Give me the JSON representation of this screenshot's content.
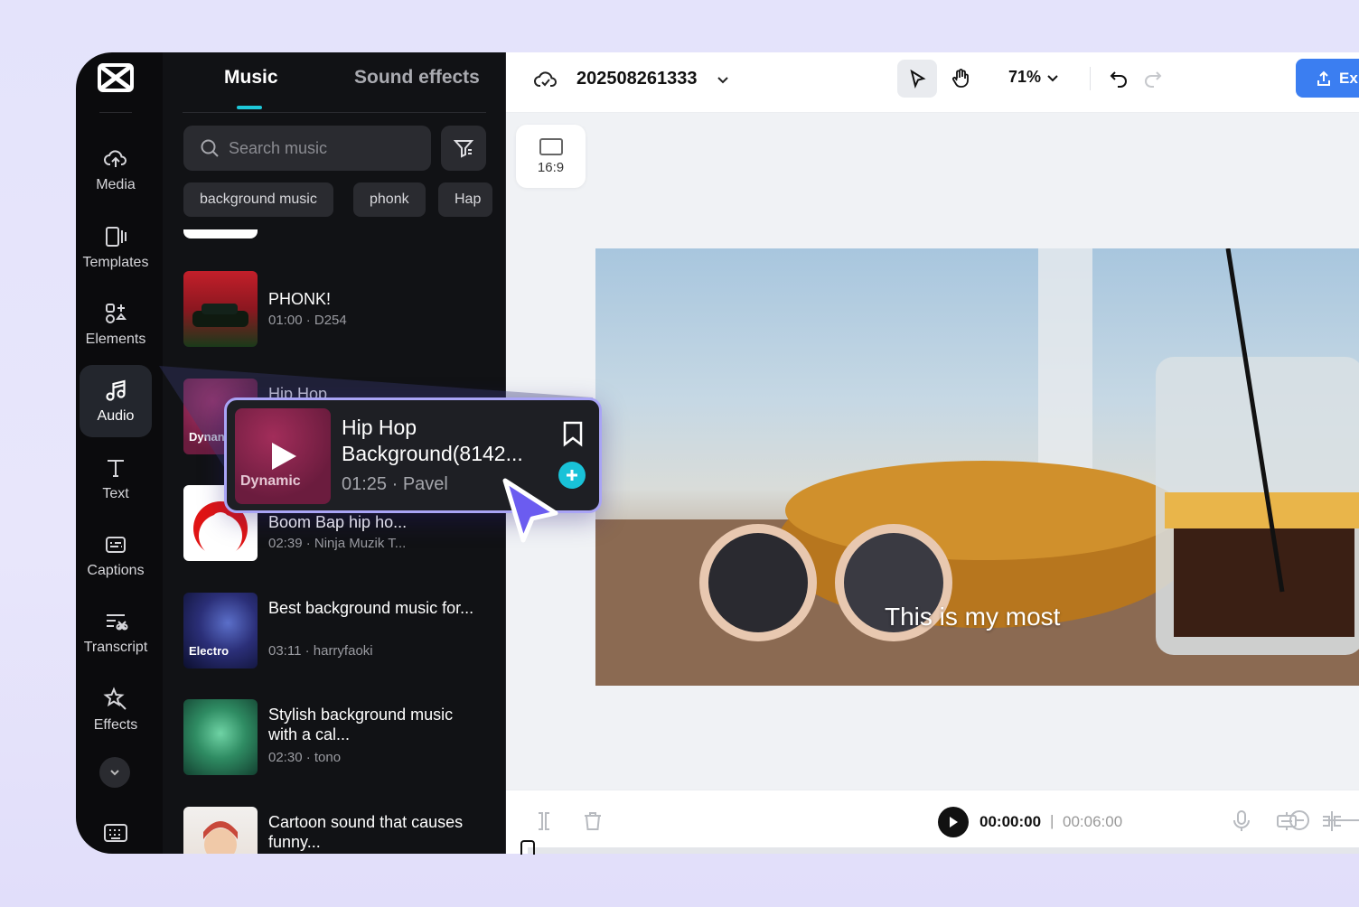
{
  "nav": {
    "items": [
      {
        "label": "Media",
        "icon": "cloud-upload-icon"
      },
      {
        "label": "Templates",
        "icon": "templates-icon"
      },
      {
        "label": "Elements",
        "icon": "elements-icon"
      },
      {
        "label": "Audio",
        "icon": "music-note-icon",
        "active": true
      },
      {
        "label": "Text",
        "icon": "text-icon"
      },
      {
        "label": "Captions",
        "icon": "captions-icon"
      },
      {
        "label": "Transcript",
        "icon": "transcript-icon"
      },
      {
        "label": "Effects",
        "icon": "effects-icon"
      }
    ]
  },
  "panel": {
    "tabs": {
      "music": "Music",
      "sound_effects": "Sound effects"
    },
    "search_placeholder": "Search music",
    "chips": [
      "background music",
      "phonk",
      "Hap"
    ],
    "tracks": [
      {
        "title": "PHONK!",
        "meta": "01:00 · D254",
        "tag": ""
      },
      {
        "title": "Hip Hop",
        "meta": "",
        "tag": "Dynan"
      },
      {
        "title": "Boom Bap hip ho...",
        "meta": "02:39 · Ninja Muzik T...",
        "tag": ""
      },
      {
        "title": "Best background music for...",
        "meta": "03:11 · harryfaoki",
        "tag": "Electro"
      },
      {
        "title": "Stylish background music with a cal...",
        "meta": "02:30 · tono",
        "tag": ""
      },
      {
        "title": "Cartoon sound that causes funny...",
        "meta": "",
        "tag": ""
      }
    ]
  },
  "popup": {
    "title": "Hip Hop Background(8142...",
    "meta": "01:25 · Pavel",
    "tag": "Dynamic"
  },
  "topbar": {
    "project_name": "202508261333",
    "zoom": "71%",
    "export_label": "Ex"
  },
  "canvas": {
    "aspect_ratio": "16:9",
    "caption": "This is my most"
  },
  "playback": {
    "current_time": "00:00:00",
    "separator": "|",
    "total_time": "00:06:00"
  },
  "colors": {
    "accent": "#1ec8d9",
    "export": "#3b7ef1",
    "popup_border": "#a9a4f6",
    "cursor": "#6b5cf0"
  }
}
